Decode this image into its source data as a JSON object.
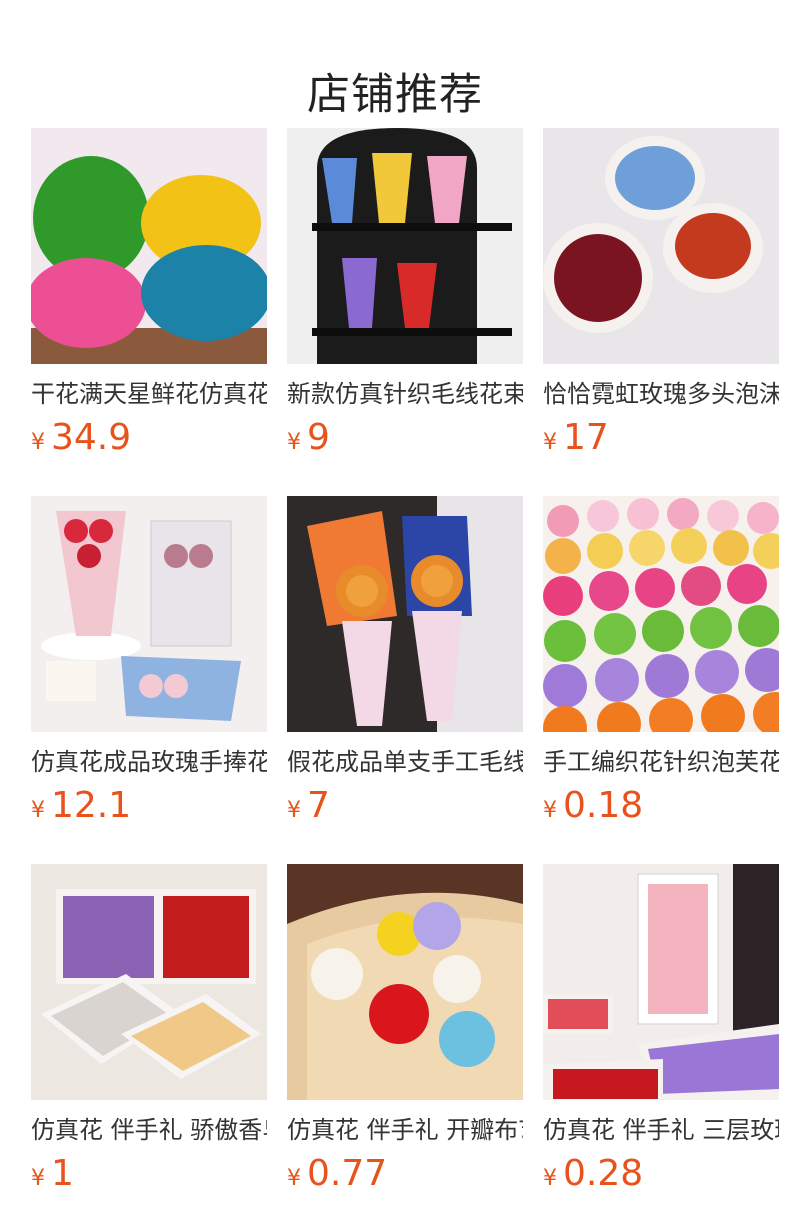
{
  "page": {
    "title": "店铺推荐"
  },
  "colors": {
    "price": "#e8531c",
    "text": "#333333"
  },
  "products": [
    {
      "name": "干花满天星鲜花仿真花",
      "currency": "¥",
      "price": "34.9",
      "image": "dried-gypsophila-bundles"
    },
    {
      "name": "新款仿真针织毛线花束",
      "currency": "¥",
      "price": "9",
      "image": "knitted-wool-bouquets-on-shelf"
    },
    {
      "name": "恰恰霓虹玫瑰多头泡沫花",
      "currency": "¥",
      "price": "17",
      "image": "neon-rose-bunches"
    },
    {
      "name": "仿真花成品玫瑰手捧花束",
      "currency": "¥",
      "price": "12.1",
      "image": "rose-hand-bouquets"
    },
    {
      "name": "假花成品单支手工毛线花",
      "currency": "¥",
      "price": "7",
      "image": "sunflower-knitted-bouquets"
    },
    {
      "name": "手工编织花针织泡芙花朵",
      "currency": "¥",
      "price": "0.18",
      "image": "crochet-puff-flowers"
    },
    {
      "name": "仿真花 伴手礼 骄傲香皂花",
      "currency": "¥",
      "price": "1",
      "image": "soap-rose-boxes"
    },
    {
      "name": "仿真花 伴手礼 开瓣布艺花",
      "currency": "¥",
      "price": "0.77",
      "image": "fabric-lily-flowers"
    },
    {
      "name": "仿真花 伴手礼 三层玫瑰香皂花",
      "currency": "¥",
      "price": "0.28",
      "image": "three-layer-soap-roses"
    }
  ]
}
